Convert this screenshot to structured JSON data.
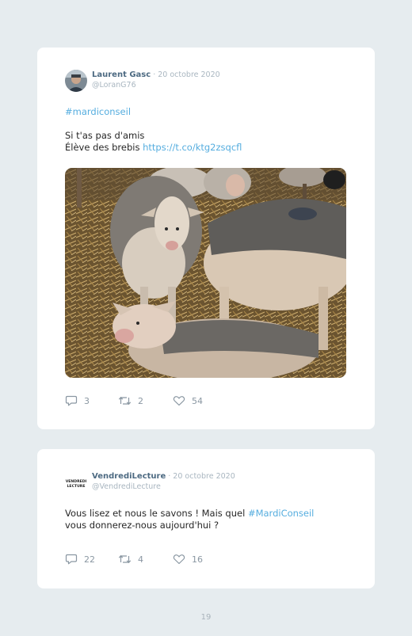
{
  "tweets": [
    {
      "author": "Laurent Gasc",
      "date": " · 20 octobre 2020",
      "handle": "@LoranG76",
      "hashtag": "#mardiconseil",
      "line1": "Si t'as pas d'amis",
      "line2_text": "Élève des brebis ",
      "line2_link": "https://t.co/ktg2zsqcfl",
      "replies": "3",
      "retweets": "2",
      "likes": "54"
    },
    {
      "author": "VendrediLecture",
      "date": " · 20 octobre 2020",
      "handle": "@VendrediLecture",
      "logo_text_top": "VENDREDI",
      "logo_text_bottom": "LECTURE",
      "line1_text": "Vous lisez et nous le savons ! Mais quel ",
      "line1_link": "#MardiConseil",
      "line2": "vous donnerez-nous aujourd'hui ?",
      "replies": "22",
      "retweets": "4",
      "likes": "16"
    }
  ],
  "page_number": "19",
  "colors": {
    "background": "#e6ecef",
    "card": "#ffffff",
    "link": "#55addf",
    "author_name": "#4d6a82",
    "muted": "#a9b6c0"
  },
  "icons": [
    "reply-icon",
    "retweet-icon",
    "like-icon"
  ]
}
